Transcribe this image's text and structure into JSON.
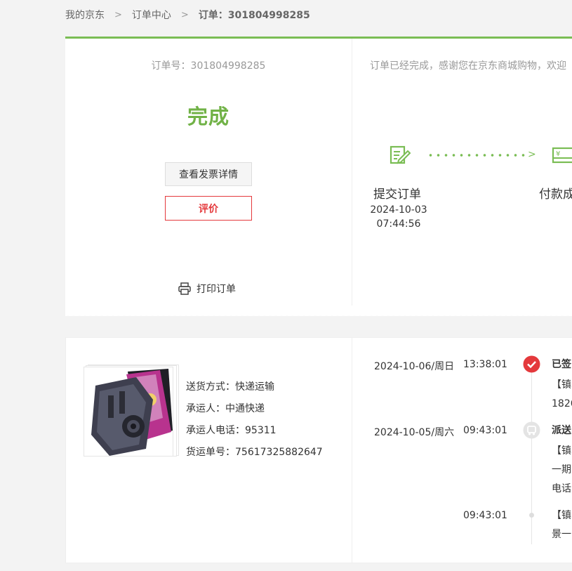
{
  "breadcrumb": {
    "home": "我的京东",
    "sep1": ">",
    "order_center": "订单中心",
    "sep2": ">",
    "current": "订单：301804998285"
  },
  "order": {
    "number_label": "订单号：301804998285",
    "status": "完成",
    "invoice_button": "查看发票详情",
    "review_button": "评价",
    "print_label": "打印订单",
    "notice": "订单已经完成，感谢您在京东商城购物，欢迎"
  },
  "progress": {
    "steps": [
      {
        "label": "提交订单",
        "date": "2024-10-03",
        "time": "07:44:56",
        "icon": "edit-document-icon"
      },
      {
        "label": "付款成",
        "icon": "payment-icon"
      }
    ],
    "arrow": ">"
  },
  "shipment": {
    "method": "送货方式：快递运输",
    "carrier": "承运人：中通快递",
    "carrier_phone": "承运人电话：95311",
    "tracking_no": "货运单号：75617325882647"
  },
  "timeline": [
    {
      "date": "2024-10-06/周日",
      "time": "13:38:01",
      "title": "已签",
      "line1": "【镇",
      "line2": "1826",
      "icon": "signed-check-icon"
    },
    {
      "date": "2024-10-05/周六",
      "time": "09:43:01",
      "title": "派送",
      "line1": "【镇",
      "line2": "一期",
      "line3": "电话",
      "icon": "delivery-icon"
    },
    {
      "date": "",
      "time": "09:43:01",
      "line1": "【镇",
      "line2": "景一"
    }
  ],
  "colors": {
    "accent_green": "#7abd54",
    "status_green": "#71b247",
    "jd_red": "#e4393c"
  }
}
